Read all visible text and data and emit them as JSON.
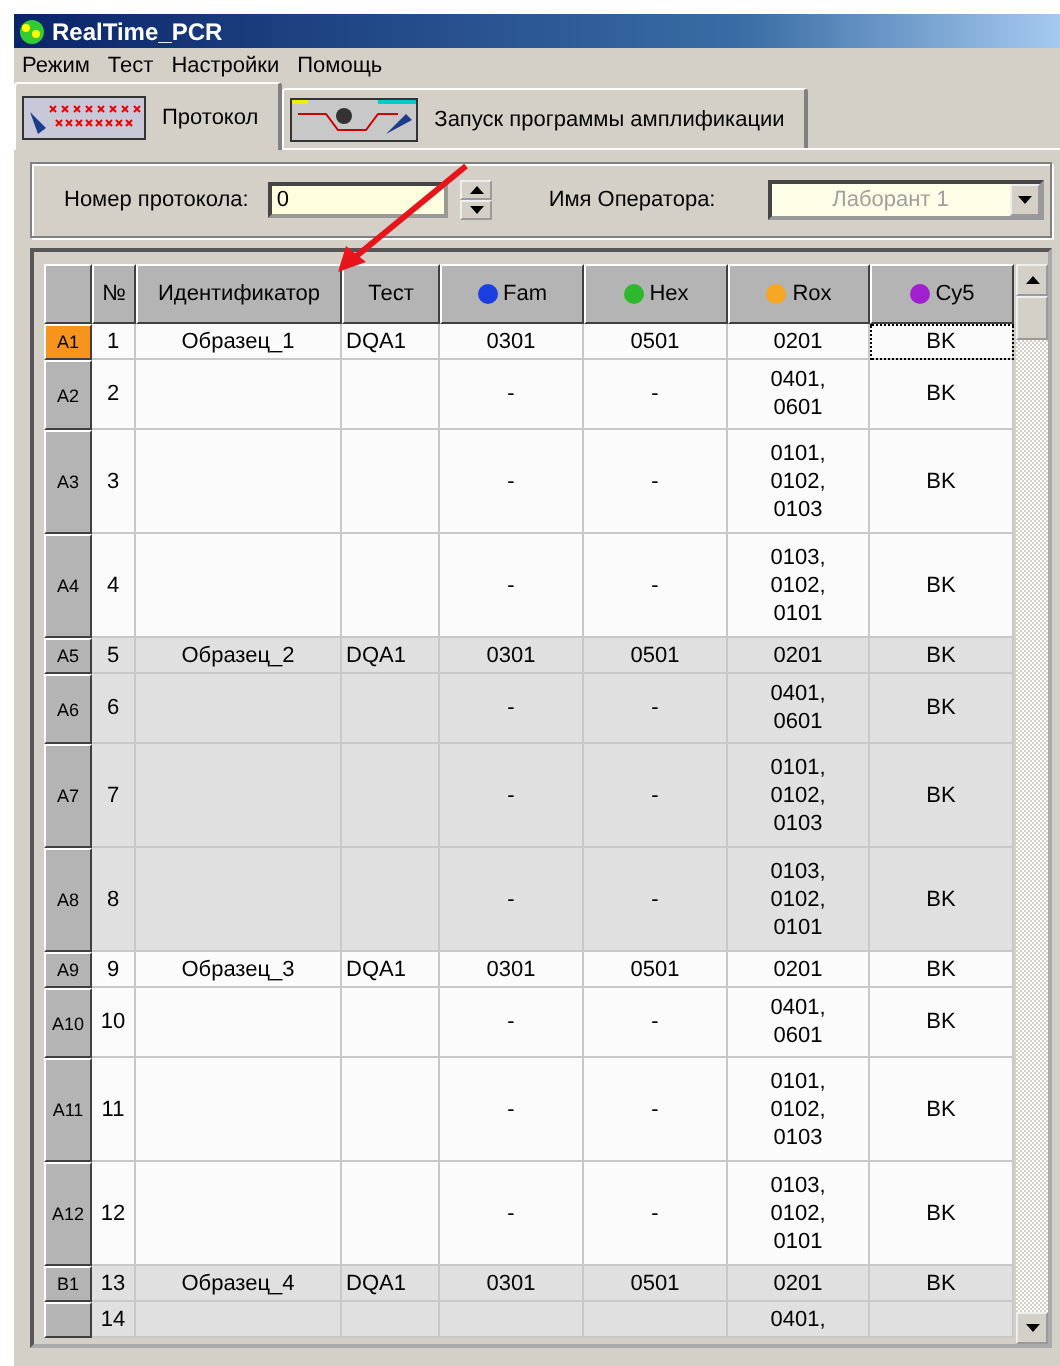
{
  "window": {
    "title": "RealTime_PCR"
  },
  "menu": [
    "Режим",
    "Тест",
    "Настройки",
    "Помощь"
  ],
  "tabs": [
    {
      "label": "Протокол",
      "selected": true
    },
    {
      "label": "Запуск программы амплификации",
      "selected": false
    }
  ],
  "protocol": {
    "number_label": "Номер протокола:",
    "number_value": "0",
    "operator_label": "Имя Оператора:",
    "operator_value": "Лаборант 1",
    "operator_disabled": true
  },
  "table": {
    "columns": [
      {
        "label": "№"
      },
      {
        "label": "Идентификатор"
      },
      {
        "label": "Тест"
      },
      {
        "label": "Fam",
        "color": "#1a3ee0"
      },
      {
        "label": "Hex",
        "color": "#2eb82e"
      },
      {
        "label": "Rox",
        "color": "#f5a623"
      },
      {
        "label": "Cy5",
        "color": "#a020d0"
      }
    ],
    "rows": [
      {
        "well": "A1",
        "num": "1",
        "id": "Образец_1",
        "test": "DQA1",
        "fam": "0301",
        "hex": "0501",
        "rox": [
          "0201"
        ],
        "cy5": "BK",
        "shaded": false,
        "selected": true
      },
      {
        "well": "A2",
        "num": "2",
        "fam": "-",
        "hex": "-",
        "rox": [
          "0401,",
          "0601"
        ],
        "cy5": "BK",
        "shaded": false,
        "selected": false
      },
      {
        "well": "A3",
        "num": "3",
        "fam": "-",
        "hex": "-",
        "rox": [
          "0101,",
          "0102,",
          "0103"
        ],
        "cy5": "BK",
        "shaded": false,
        "selected": false
      },
      {
        "well": "A4",
        "num": "4",
        "fam": "-",
        "hex": "-",
        "rox": [
          "0103,",
          "0102,",
          "0101"
        ],
        "cy5": "BK",
        "shaded": false,
        "selected": false
      },
      {
        "well": "A5",
        "num": "5",
        "id": "Образец_2",
        "test": "DQA1",
        "fam": "0301",
        "hex": "0501",
        "rox": [
          "0201"
        ],
        "cy5": "BK",
        "shaded": true,
        "selected": false
      },
      {
        "well": "A6",
        "num": "6",
        "fam": "-",
        "hex": "-",
        "rox": [
          "0401,",
          "0601"
        ],
        "cy5": "BK",
        "shaded": true,
        "selected": false
      },
      {
        "well": "A7",
        "num": "7",
        "fam": "-",
        "hex": "-",
        "rox": [
          "0101,",
          "0102,",
          "0103"
        ],
        "cy5": "BK",
        "shaded": true,
        "selected": false
      },
      {
        "well": "A8",
        "num": "8",
        "fam": "-",
        "hex": "-",
        "rox": [
          "0103,",
          "0102,",
          "0101"
        ],
        "cy5": "BK",
        "shaded": true,
        "selected": false
      },
      {
        "well": "A9",
        "num": "9",
        "id": "Образец_3",
        "test": "DQA1",
        "fam": "0301",
        "hex": "0501",
        "rox": [
          "0201"
        ],
        "cy5": "BK",
        "shaded": false,
        "selected": false
      },
      {
        "well": "A10",
        "num": "10",
        "fam": "-",
        "hex": "-",
        "rox": [
          "0401,",
          "0601"
        ],
        "cy5": "BK",
        "shaded": false,
        "selected": false
      },
      {
        "well": "A11",
        "num": "11",
        "fam": "-",
        "hex": "-",
        "rox": [
          "0101,",
          "0102,",
          "0103"
        ],
        "cy5": "BK",
        "shaded": false,
        "selected": false
      },
      {
        "well": "A12",
        "num": "12",
        "fam": "-",
        "hex": "-",
        "rox": [
          "0103,",
          "0102,",
          "0101"
        ],
        "cy5": "BK",
        "shaded": false,
        "selected": false
      },
      {
        "well": "B1",
        "num": "13",
        "id": "Образец_4",
        "test": "DQA1",
        "fam": "0301",
        "hex": "0501",
        "rox": [
          "0201"
        ],
        "cy5": "BK",
        "shaded": true,
        "selected": false
      },
      {
        "num": "14",
        "rox": [
          "0401,"
        ],
        "shaded": true,
        "selected": false
      }
    ]
  }
}
